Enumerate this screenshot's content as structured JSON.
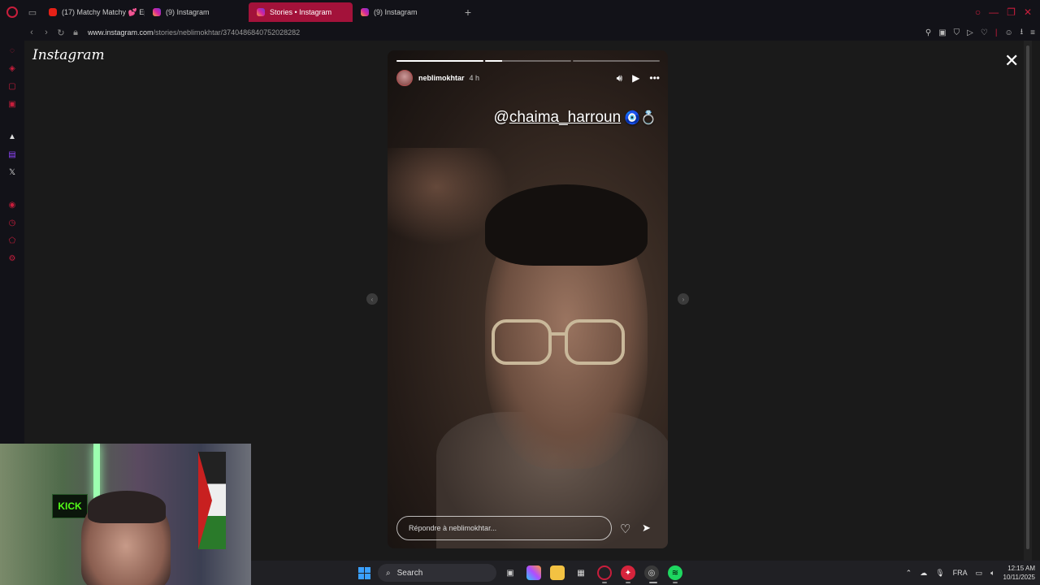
{
  "browser": {
    "tabs": [
      {
        "label": "(17) Matchy Matchy 💕 Ep",
        "icon": "youtube-icon",
        "active": false
      },
      {
        "label": "(9) Instagram",
        "icon": "instagram-icon",
        "active": false
      },
      {
        "label": "Stories • Instagram",
        "icon": "instagram-icon",
        "active": true
      },
      {
        "label": "(9) Instagram",
        "icon": "instagram-icon",
        "active": false
      }
    ],
    "url_host": "www.instagram.com",
    "url_path": "/stories/neblimokhtar/3740486840752028282"
  },
  "page": {
    "logo": "Instagram"
  },
  "story": {
    "username": "neblimokhtar",
    "time": "4 h",
    "progress": [
      1,
      0.2,
      0
    ],
    "mention_prefix": "@",
    "mention_handle": "chaima_harroun",
    "mention_emoji": "🧿💍",
    "reply_placeholder": "Répondre à neblimokhtar..."
  },
  "taskbar": {
    "search_label": "Search",
    "language": "FRA",
    "time": "12:15 AM",
    "date": "10/11/2025"
  },
  "webcam": {
    "sign": "KICK"
  },
  "colors": {
    "opera_red": "#c81e3c",
    "active_tab": "#a3123a",
    "kick_green": "#53fc18"
  }
}
